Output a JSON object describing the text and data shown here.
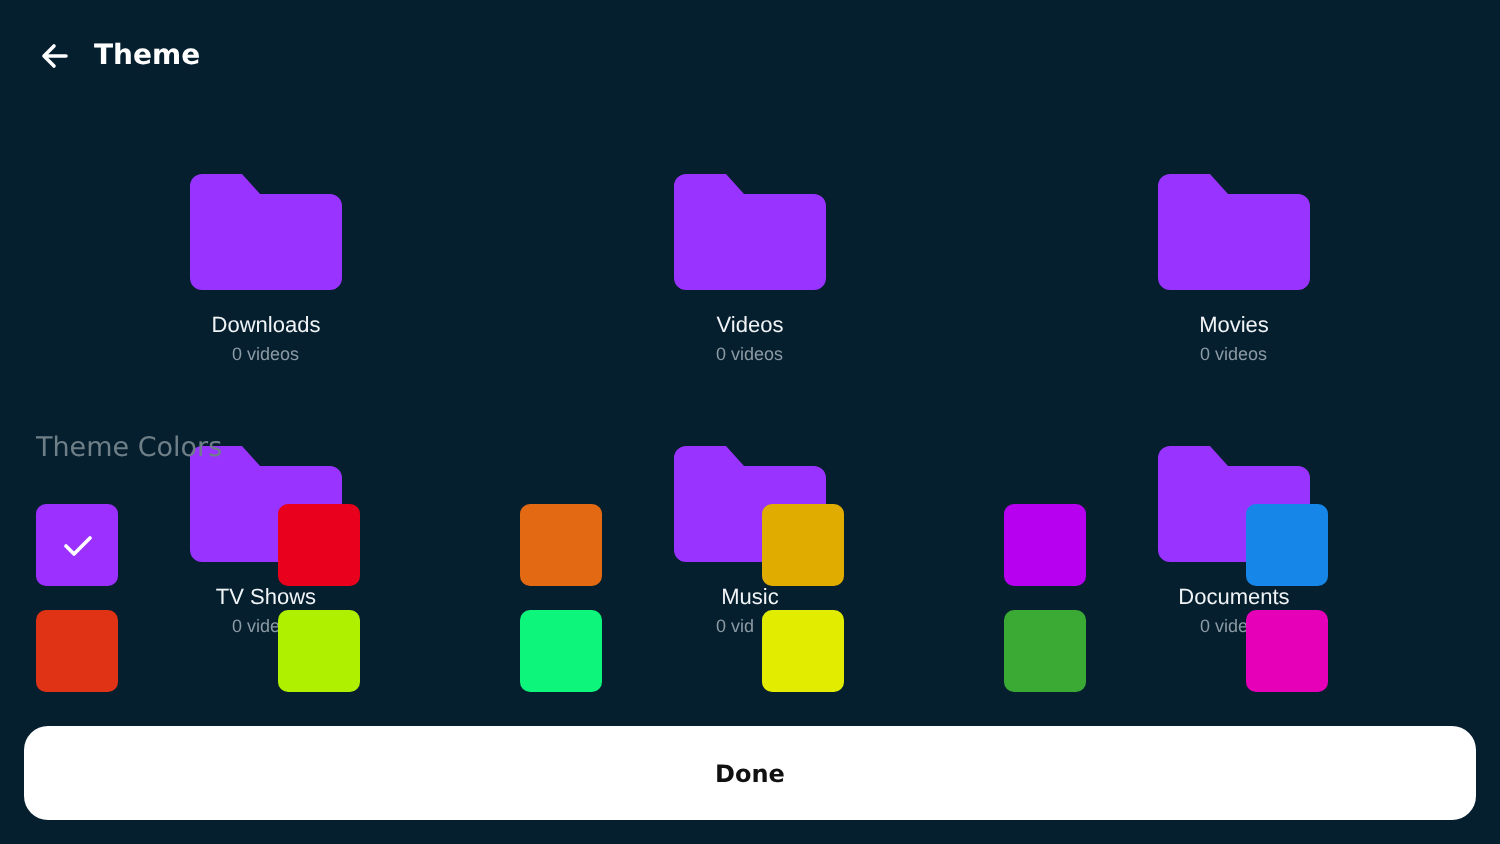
{
  "header": {
    "title": "Theme"
  },
  "folders": [
    {
      "name": "Downloads",
      "count": "0 videos"
    },
    {
      "name": "Videos",
      "count": "0 videos"
    },
    {
      "name": "Movies",
      "count": "0 videos"
    },
    {
      "name": "TV Shows",
      "count": "0 vide"
    },
    {
      "name": "Music",
      "count": "0 vid"
    },
    {
      "name": "Documents",
      "count": "0 vide"
    }
  ],
  "theme_colors": {
    "title": "Theme Colors",
    "swatches": [
      {
        "color": "#9b30ff",
        "selected": true
      },
      {
        "color": "#e8001c",
        "selected": false
      },
      {
        "color": "#e36a12",
        "selected": false
      },
      {
        "color": "#e0ac00",
        "selected": false
      },
      {
        "color": "#b700f0",
        "selected": false
      },
      {
        "color": "#1687e8",
        "selected": false
      },
      {
        "color": "#e03214",
        "selected": false
      },
      {
        "color": "#aef000",
        "selected": false
      },
      {
        "color": "#0df57a",
        "selected": false
      },
      {
        "color": "#e2ec00",
        "selected": false
      },
      {
        "color": "#3aaa35",
        "selected": false
      },
      {
        "color": "#e600b8",
        "selected": false
      }
    ]
  },
  "done_button": {
    "label": "Done"
  }
}
